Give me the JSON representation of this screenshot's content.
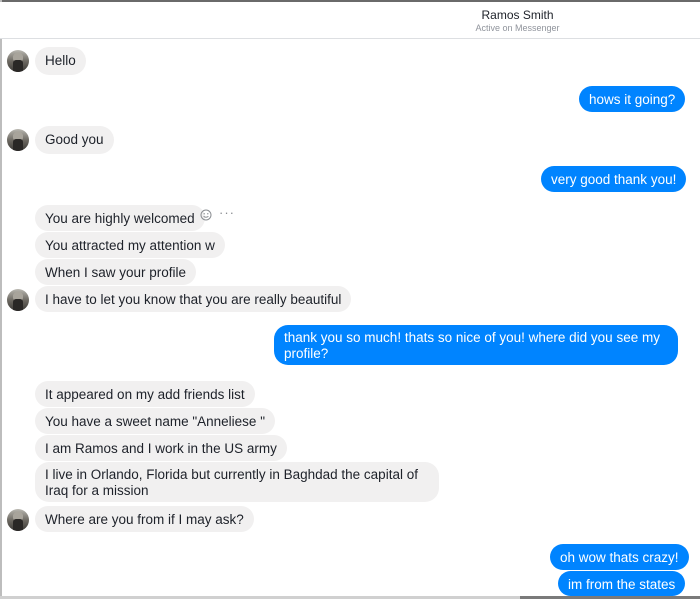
{
  "header": {
    "name": "Ramos Smith",
    "status": "Active on Messenger"
  },
  "messages": [
    {
      "side": "in",
      "text": "Hello"
    },
    {
      "side": "out",
      "text": "hows it going?"
    },
    {
      "side": "in",
      "text": "Good you"
    },
    {
      "side": "out",
      "text": "very good thank you!"
    },
    {
      "side": "in",
      "text": "You are highly welcomed"
    },
    {
      "side": "in",
      "text": "You attracted my attention w"
    },
    {
      "side": "in",
      "text": "When I saw your profile"
    },
    {
      "side": "in",
      "text": "I have to let you know that you are really beautiful"
    },
    {
      "side": "out",
      "text": "thank you so much! thats so nice of you! where did you see my profile?"
    },
    {
      "side": "in",
      "text": "It appeared on my add friends list"
    },
    {
      "side": "in",
      "text": "You have a sweet name \"Anneliese \""
    },
    {
      "side": "in",
      "text": "I am Ramos and I work in the US army"
    },
    {
      "side": "in",
      "text": "I live in Orlando, Florida but currently in Baghdad the capital of Iraq for a mission"
    },
    {
      "side": "in",
      "text": "Where are you from if I may ask?"
    },
    {
      "side": "out",
      "text": "oh wow thats crazy!"
    },
    {
      "side": "out",
      "text": "im from the states"
    }
  ],
  "icons": {
    "avatar": "avatar",
    "reaction": "smile-icon",
    "more": "more-icon"
  },
  "colors": {
    "outgoing_bubble": "#0084ff",
    "incoming_bubble": "#f1f0f0",
    "outgoing_text": "#ffffff",
    "incoming_text": "#1d2129"
  }
}
